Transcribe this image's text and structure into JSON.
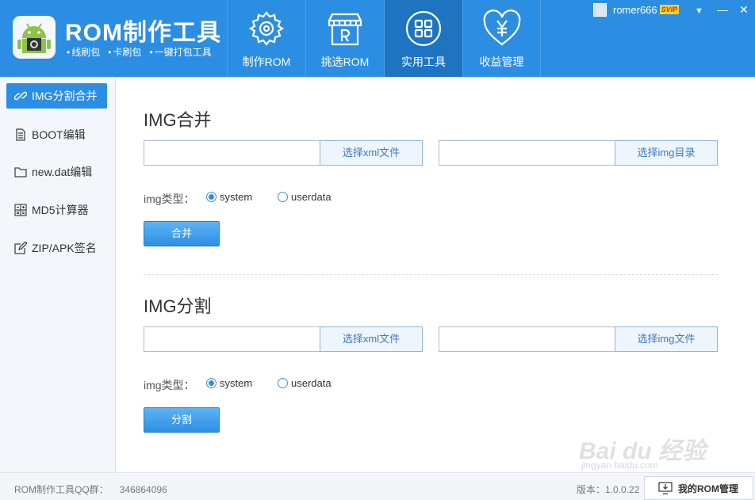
{
  "app": {
    "title": "ROM制作工具",
    "features": [
      "线刷包",
      "卡刷包",
      "一键打包工具"
    ]
  },
  "nav": {
    "tabs": [
      {
        "label": "制作ROM",
        "icon": "gear-icon"
      },
      {
        "label": "挑选ROM",
        "icon": "shop-icon"
      },
      {
        "label": "实用工具",
        "icon": "grid-icon",
        "active": true
      },
      {
        "label": "收益管理",
        "icon": "heart-yen-icon"
      }
    ]
  },
  "user": {
    "name": "romer666",
    "badge": "SVIP",
    "menu_glyph": "▼",
    "minimize_glyph": "—",
    "close_glyph": "✕"
  },
  "sidebar": {
    "items": [
      {
        "label": "IMG分割合并",
        "icon": "link-icon",
        "active": true
      },
      {
        "label": "BOOT编辑",
        "icon": "document-icon"
      },
      {
        "label": "new.dat编辑",
        "icon": "folder-icon"
      },
      {
        "label": "MD5计算器",
        "icon": "calculator-icon"
      },
      {
        "label": "ZIP/APK签名",
        "icon": "edit-icon"
      }
    ]
  },
  "merge": {
    "title": "IMG合并",
    "input1_value": "",
    "btn1": "选择xml文件",
    "input2_value": "",
    "btn2": "选择img目录",
    "type_label": "img类型：",
    "options": [
      "system",
      "userdata"
    ],
    "selected": "system",
    "action": "合并"
  },
  "split": {
    "title": "IMG分割",
    "input1_value": "",
    "btn1": "选择xml文件",
    "input2_value": "",
    "btn2": "选择img文件",
    "type_label": "img类型：",
    "options": [
      "system",
      "userdata"
    ],
    "selected": "system",
    "action": "分割"
  },
  "footer": {
    "qq_label": "ROM制作工具QQ群：",
    "qq_number": "346864096",
    "version": "版本：1.0.0.22",
    "my_rom": "我的ROM管理"
  },
  "watermark": {
    "brand": "Bai du 经验",
    "url": "jingyan.baidu.com"
  },
  "colors": {
    "primary": "#2c8ee3",
    "nav_active": "#1f74c2",
    "sidebar_bg": "#f3f7fb",
    "svip": "#ffd32e"
  }
}
